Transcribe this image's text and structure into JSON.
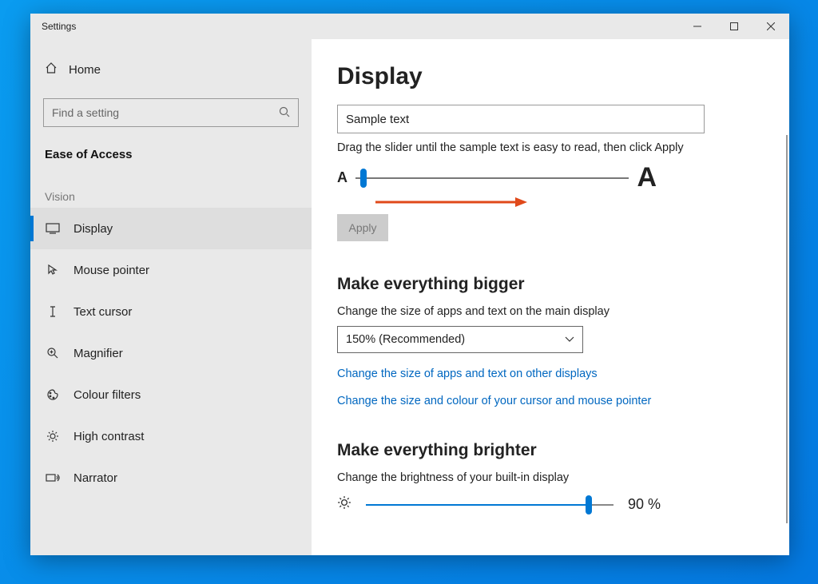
{
  "window": {
    "title": "Settings"
  },
  "sidebar": {
    "home": "Home",
    "search_placeholder": "Find a setting",
    "category": "Ease of Access",
    "group_label": "Vision",
    "items": [
      {
        "label": "Display",
        "selected": true
      },
      {
        "label": "Mouse pointer"
      },
      {
        "label": "Text cursor"
      },
      {
        "label": "Magnifier"
      },
      {
        "label": "Colour filters"
      },
      {
        "label": "High contrast"
      },
      {
        "label": "Narrator"
      }
    ]
  },
  "main": {
    "title": "Display",
    "sample_text": "Sample text",
    "slider_hint": "Drag the slider until the sample text is easy to read, then click Apply",
    "apply_label": "Apply",
    "sec1_title": "Make everything bigger",
    "sec1_sub": "Change the size of apps and text on the main display",
    "scale_value": "150% (Recommended)",
    "link1": "Change the size of apps and text on other displays",
    "link2": "Change the size and colour of your cursor and mouse pointer",
    "sec2_title": "Make everything brighter",
    "sec2_sub": "Change the brightness of your built-in display",
    "brightness_value": "90 %",
    "brightness_pct": 90
  }
}
